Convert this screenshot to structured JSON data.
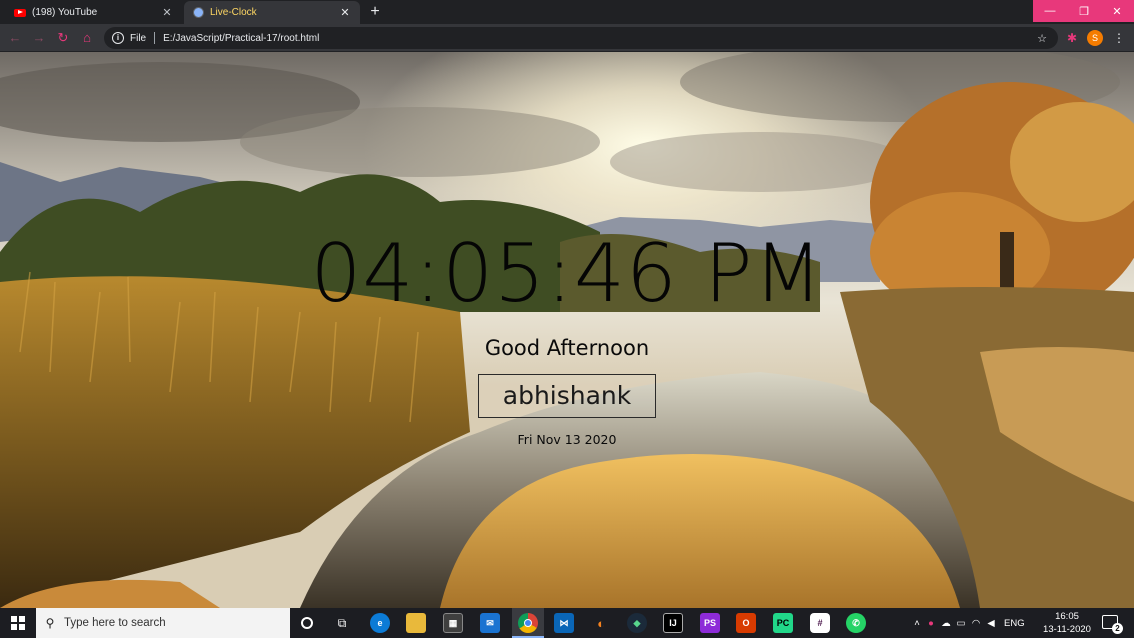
{
  "browser": {
    "tabs": [
      {
        "title": "(198) YouTube",
        "active": false,
        "icon": "youtube-icon"
      },
      {
        "title": "Live-Clock",
        "active": true,
        "icon": "globe-icon"
      }
    ],
    "address": {
      "scheme_label": "File",
      "url": "E:/JavaScript/Practical-17/root.html"
    },
    "profile_initial": "S",
    "accent_color": "#e8387b"
  },
  "page": {
    "time": "04:05:46 PM",
    "greeting": "Good Afternoon",
    "name": "abhishank",
    "date": "Fri Nov 13 2020"
  },
  "taskbar": {
    "search_placeholder": "Type here to search",
    "language": "ENG",
    "time": "16:05",
    "date": "13-11-2020",
    "notification_count": "2"
  }
}
